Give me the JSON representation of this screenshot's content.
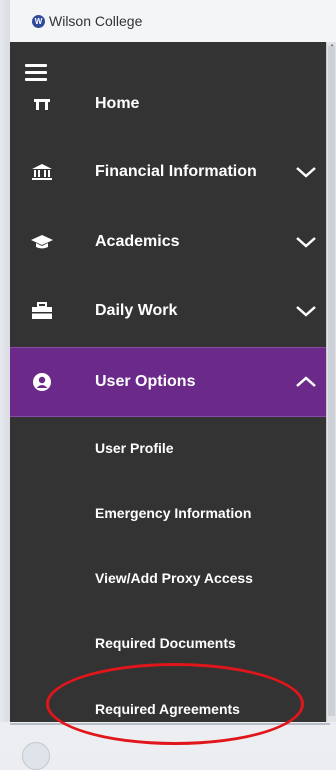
{
  "header": {
    "brand": "Wilson College",
    "logo_icon": "wilson-logo-icon"
  },
  "sidebar": {
    "menu_icon": "hamburger-icon",
    "items": [
      {
        "label": "Home",
        "icon": "home-icon",
        "expandable": false
      },
      {
        "label": "Financial Information",
        "icon": "bank-icon",
        "expandable": true,
        "expanded": false
      },
      {
        "label": "Academics",
        "icon": "graduation-cap-icon",
        "expandable": true,
        "expanded": false
      },
      {
        "label": "Daily Work",
        "icon": "briefcase-icon",
        "expandable": true,
        "expanded": false
      },
      {
        "label": "User Options",
        "icon": "user-circle-icon",
        "expandable": true,
        "expanded": true
      }
    ],
    "submenu": [
      {
        "label": "User Profile"
      },
      {
        "label": "Emergency Information"
      },
      {
        "label": "View/Add Proxy Access"
      },
      {
        "label": "Required Documents"
      },
      {
        "label": "Required Agreements"
      }
    ]
  },
  "colors": {
    "sidebar_bg": "#333333",
    "active_bg": "#6b2a8a",
    "annotation": "#e0161b",
    "logo": "#2f4b9c"
  }
}
